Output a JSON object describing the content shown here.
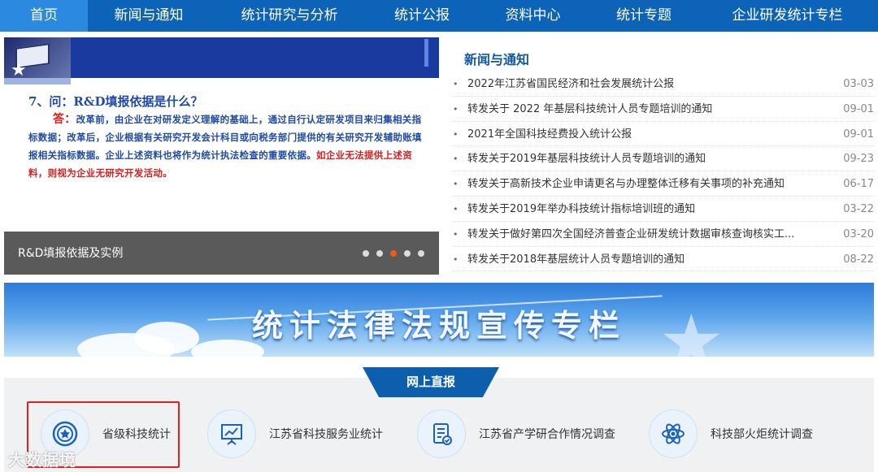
{
  "nav": {
    "items": [
      "首页",
      "新闻与通知",
      "统计研究与分析",
      "统计公报",
      "资料中心",
      "统计专题",
      "企业研发统计专栏"
    ],
    "active_index": 0,
    "color": "#0d63b8",
    "active_color": "#2b8ae0"
  },
  "slide": {
    "question": "7、问：R&D填报依据是什么？",
    "answer_label": "答：",
    "answer_text": "改革前，由企业在对研发定义理解的基础上，通过自行认定研发项目来归集相关指标数据；改革后，企业根据有关研究开发会计科目或向税务部门提供的有关研究开发辅助账填报相关指标数据。企业上述资料也将作为统计执法检查的重要依据。",
    "answer_red": "如企业无法提供上述资料，则视为企业无研究开发活动。",
    "caption": "R&D填报依据及实例",
    "dot_count": 5,
    "active_dot": 2,
    "active_dot_color": "#f05a1a"
  },
  "news": {
    "title": "新闻与通知",
    "items": [
      {
        "title": "2022年江苏省国民经济和社会发展统计公报",
        "date": "03-03"
      },
      {
        "title": "转发关于 2022 年基层科技统计人员专题培训的通知",
        "date": "09-01"
      },
      {
        "title": "2021年全国科技经费投入统计公报",
        "date": "09-01"
      },
      {
        "title": "转发关于2019年基层科技统计人员专题培训的通知",
        "date": "09-23"
      },
      {
        "title": "转发关于高新技术企业申请更名与办理整体迁移有关事项的补充通知",
        "date": "06-17"
      },
      {
        "title": "转发关于2019年举办科技统计指标培训班的通知",
        "date": "03-22"
      },
      {
        "title": "转发关于做好第四次全国经济普查企业研发统计数据审核查询核实工...",
        "date": "03-20"
      },
      {
        "title": "转发关于2018年基层统计人员专题培训的通知",
        "date": "08-22"
      }
    ]
  },
  "banner": {
    "text": "统计法律法规宣传专栏"
  },
  "report": {
    "tab_label": "网上直报",
    "cards": [
      {
        "label": "省级科技统计",
        "icon": "badge-icon"
      },
      {
        "label": "江苏省科技服务业统计",
        "icon": "presentation-chart-icon"
      },
      {
        "label": "江苏省产学研合作情况调查",
        "icon": "document-check-icon"
      },
      {
        "label": "科技部火炬统计调查",
        "icon": "atom-icon"
      }
    ],
    "highlight_color": "#e02020"
  },
  "watermark": "大数据境"
}
